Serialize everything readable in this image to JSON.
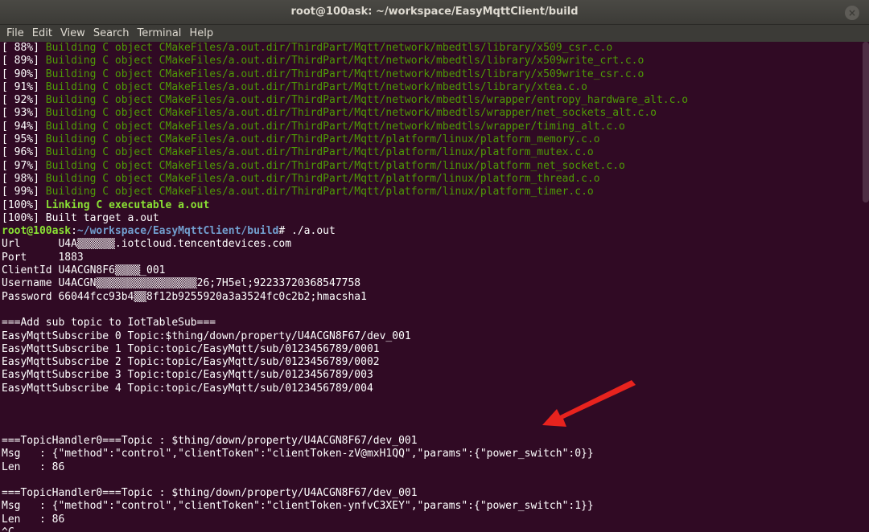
{
  "window": {
    "title": "root@100ask: ~/workspace/EasyMqttClient/build",
    "close_glyph": "×"
  },
  "menu": [
    "File",
    "Edit",
    "View",
    "Search",
    "Terminal",
    "Help"
  ],
  "build_lines": [
    {
      "pct": "[ 88%]",
      "text": "Building C object CMakeFiles/a.out.dir/ThirdPart/Mqtt/network/mbedtls/library/x509_csr.c.o"
    },
    {
      "pct": "[ 89%]",
      "text": "Building C object CMakeFiles/a.out.dir/ThirdPart/Mqtt/network/mbedtls/library/x509write_crt.c.o"
    },
    {
      "pct": "[ 90%]",
      "text": "Building C object CMakeFiles/a.out.dir/ThirdPart/Mqtt/network/mbedtls/library/x509write_csr.c.o"
    },
    {
      "pct": "[ 91%]",
      "text": "Building C object CMakeFiles/a.out.dir/ThirdPart/Mqtt/network/mbedtls/library/xtea.c.o"
    },
    {
      "pct": "[ 92%]",
      "text": "Building C object CMakeFiles/a.out.dir/ThirdPart/Mqtt/network/mbedtls/wrapper/entropy_hardware_alt.c.o"
    },
    {
      "pct": "[ 93%]",
      "text": "Building C object CMakeFiles/a.out.dir/ThirdPart/Mqtt/network/mbedtls/wrapper/net_sockets_alt.c.o"
    },
    {
      "pct": "[ 94%]",
      "text": "Building C object CMakeFiles/a.out.dir/ThirdPart/Mqtt/network/mbedtls/wrapper/timing_alt.c.o"
    },
    {
      "pct": "[ 95%]",
      "text": "Building C object CMakeFiles/a.out.dir/ThirdPart/Mqtt/platform/linux/platform_memory.c.o"
    },
    {
      "pct": "[ 96%]",
      "text": "Building C object CMakeFiles/a.out.dir/ThirdPart/Mqtt/platform/linux/platform_mutex.c.o"
    },
    {
      "pct": "[ 97%]",
      "text": "Building C object CMakeFiles/a.out.dir/ThirdPart/Mqtt/platform/linux/platform_net_socket.c.o"
    },
    {
      "pct": "[ 98%]",
      "text": "Building C object CMakeFiles/a.out.dir/ThirdPart/Mqtt/platform/linux/platform_thread.c.o"
    },
    {
      "pct": "[ 99%]",
      "text": "Building C object CMakeFiles/a.out.dir/ThirdPart/Mqtt/platform/linux/platform_timer.c.o"
    }
  ],
  "link_line": {
    "pct": "[100%]",
    "text": "Linking C executable a.out"
  },
  "built_line": {
    "pct": "[100%]",
    "text": "Built target a.out"
  },
  "prompt": {
    "user": "root@100ask",
    "sep": ":",
    "path": "~/workspace/EasyMqttClient/build",
    "symbol": "#",
    "command": " ./a.out"
  },
  "connection": [
    "Url      U4A▒▒▒▒▒▒.iotcloud.tencentdevices.com",
    "Port     1883",
    "ClientId U4ACGN8F6▒▒▒▒_001",
    "Username U4ACGN▒▒▒▒▒▒▒▒▒▒▒▒▒▒▒▒26;7H5el;92233720368547758",
    "Password 66044fcc93b4▒▒8f12b9255920a3a3524fc0c2b2;hmacsha1"
  ],
  "subscribe": [
    "===Add sub topic to IotTableSub===",
    "EasyMqttSubscribe 0 Topic:$thing/down/property/U4ACGN8F67/dev_001",
    "EasyMqttSubscribe 1 Topic:topic/EasyMqtt/sub/0123456789/0001",
    "EasyMqttSubscribe 2 Topic:topic/EasyMqtt/sub/0123456789/0002",
    "EasyMqttSubscribe 3 Topic:topic/EasyMqtt/sub/0123456789/003",
    "EasyMqttSubscribe 4 Topic:topic/EasyMqtt/sub/0123456789/004"
  ],
  "handler1": [
    "===TopicHandler0===Topic : $thing/down/property/U4ACGN8F67/dev_001",
    "Msg   : {\"method\":\"control\",\"clientToken\":\"clientToken-zV@mxH1QQ\",\"params\":{\"power_switch\":0}}",
    "Len   : 86"
  ],
  "handler2": [
    "===TopicHandler0===Topic : $thing/down/property/U4ACGN8F67/dev_001",
    "Msg   : {\"method\":\"control\",\"clientToken\":\"clientToken-ynfvC3XEY\",\"params\":{\"power_switch\":1}}",
    "Len   : 86",
    "^C"
  ],
  "colors": {
    "background": "#300a24",
    "green": "#4e9a06",
    "bright_green": "#8ae234",
    "blue": "#729fcf",
    "arrow": "#e8231e"
  }
}
